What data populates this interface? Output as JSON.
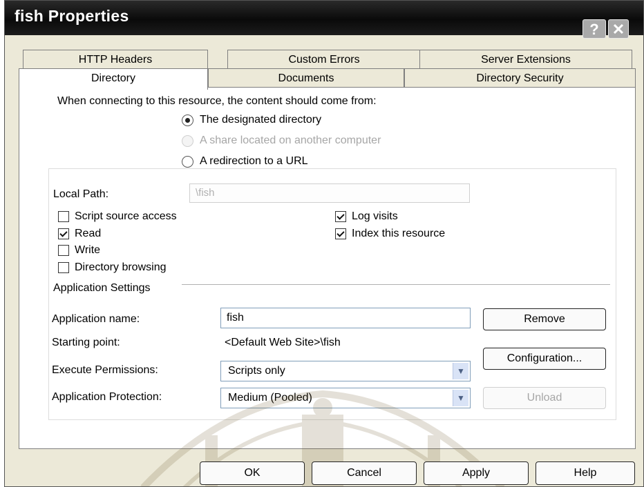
{
  "window": {
    "title": "fish Properties",
    "help_button": "?",
    "close_button": "✕"
  },
  "tabs": {
    "row1": [
      "HTTP Headers",
      "Custom Errors",
      "Server Extensions"
    ],
    "row2": [
      "Directory",
      "Documents",
      "Directory Security"
    ],
    "active": "Directory"
  },
  "content_source": {
    "prompt": "When connecting to this resource, the content should come from:",
    "options": [
      {
        "label": "The designated directory",
        "selected": true,
        "enabled": true
      },
      {
        "label": "A share located on another computer",
        "selected": false,
        "enabled": false
      },
      {
        "label": "A redirection to a URL",
        "selected": false,
        "enabled": true
      }
    ]
  },
  "local_path": {
    "label": "Local Path:",
    "value": "\\fish"
  },
  "permissions": {
    "script_source_access": {
      "label": "Script source access",
      "checked": false
    },
    "read": {
      "label": "Read",
      "checked": true
    },
    "write": {
      "label": "Write",
      "checked": false
    },
    "directory_browsing": {
      "label": "Directory browsing",
      "checked": false
    },
    "log_visits": {
      "label": "Log visits",
      "checked": true
    },
    "index_resource": {
      "label": "Index this resource",
      "checked": true
    }
  },
  "application": {
    "section_title": "Application Settings",
    "name_label": "Application name:",
    "name_value": "fish",
    "starting_point_label": "Starting point:",
    "starting_point_value": "<Default Web Site>\\fish",
    "execute_label": "Execute Permissions:",
    "execute_value": "Scripts only",
    "protection_label": "Application Protection:",
    "protection_value": "Medium (Pooled)",
    "remove_button": "Remove",
    "configuration_button": "Configuration...",
    "unload_button": "Unload"
  },
  "footer": {
    "ok": "OK",
    "cancel": "Cancel",
    "apply": "Apply",
    "help": "Help"
  },
  "colors": {
    "titlebar": "#111111",
    "dialog_face": "#ece9d8",
    "panel": "#ffffff",
    "disabled_text": "#a6a6a6"
  },
  "icons": {
    "help": "question-mark-icon",
    "close": "close-icon",
    "dropdown": "chevron-down-icon"
  }
}
